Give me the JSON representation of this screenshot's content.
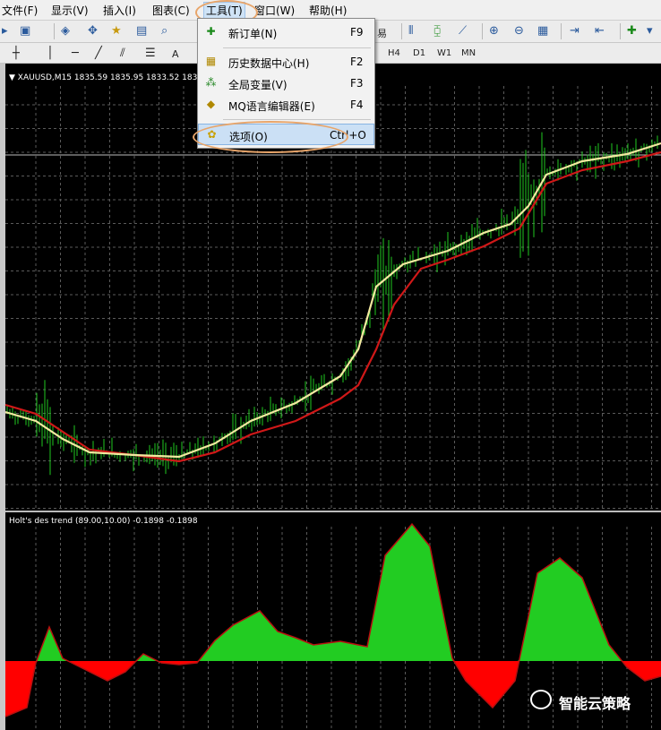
{
  "menubar": {
    "items": [
      {
        "label": "文件(F)"
      },
      {
        "label": "显示(V)"
      },
      {
        "label": "插入(I)"
      },
      {
        "label": "图表(C)"
      },
      {
        "label": "工具(T)"
      },
      {
        "label": "窗口(W)"
      },
      {
        "label": "帮助(H)"
      }
    ]
  },
  "toolbar": {
    "timeframes": [
      "H4",
      "D1",
      "W1",
      "MN"
    ],
    "partial_label": "易",
    "text_tool": "A"
  },
  "dropdown": {
    "items": [
      {
        "label": "新订单(N)",
        "shortcut": "F9",
        "icon": "new-order-icon"
      },
      {
        "label": "历史数据中心(H)",
        "shortcut": "F2",
        "icon": "history-center-icon"
      },
      {
        "label": "全局变量(V)",
        "shortcut": "F3",
        "icon": "global-variables-icon"
      },
      {
        "label": "MQ语言编辑器(E)",
        "shortcut": "F4",
        "icon": "metaeditor-icon"
      },
      {
        "label": "选项(O)",
        "shortcut": "Ctrl+O",
        "icon": "options-icon"
      }
    ]
  },
  "chart": {
    "header": "XAUUSD,M15  1835.59 1835.95 1833.52 1833...",
    "indicator_header": "Holt's des trend (89.00,10.00) -0.1898 -0.1898"
  },
  "watermark": {
    "text": "智能云策略"
  },
  "colors": {
    "price": "#1fc71f",
    "fast_ma": "#f3e9a0",
    "slow_ma": "#d01818",
    "hist_up": "#22cc22",
    "hist_down": "#ff0000",
    "grid": "#5a5a5a",
    "highlight_ring": "#e8a56a"
  }
}
